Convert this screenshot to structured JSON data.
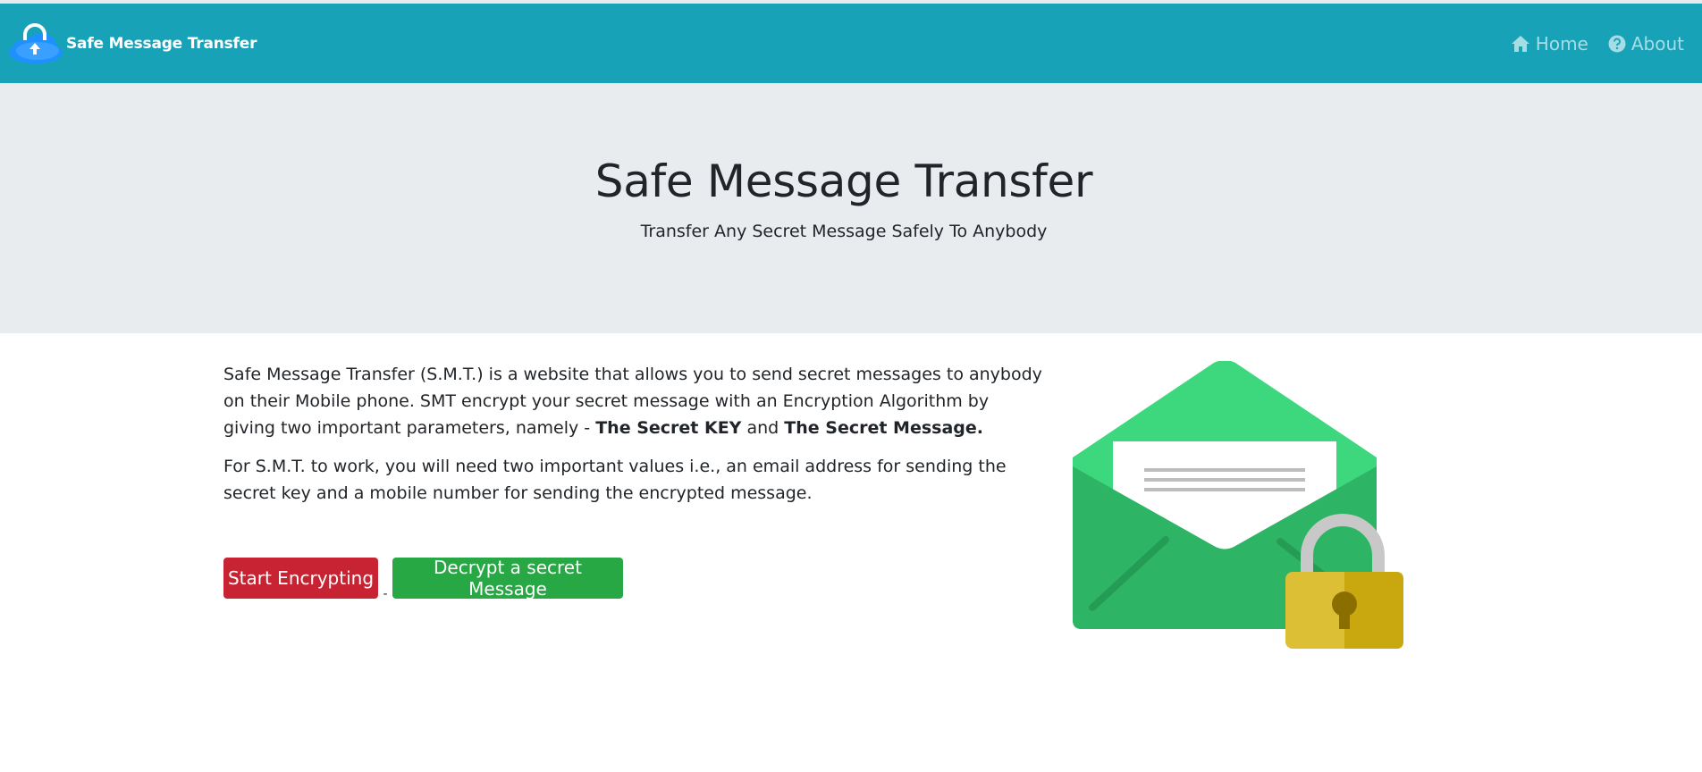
{
  "navbar": {
    "brand": "Safe Message Transfer",
    "links": [
      {
        "label": "Home",
        "icon": "home-icon"
      },
      {
        "label": "About",
        "icon": "question-circle-icon"
      }
    ]
  },
  "hero": {
    "title": "Safe Message Transfer",
    "subtitle": "Transfer Any Secret Message Safely To Anybody"
  },
  "content": {
    "p1_text": "Safe Message Transfer (S.M.T.) is a website that allows you to send secret messages to anybody on their Mobile phone. SMT encrypt your secret message with an Encryption Algorithm by giving two important parameters, namely - ",
    "p1_bold1": "The Secret KEY",
    "p1_and": " and ",
    "p1_bold2": "The Secret Message.",
    "p2": "For S.M.T. to work, you will need two important values i.e., an email address for sending the secret key and a mobile number for sending the encrypted message."
  },
  "buttons": {
    "encrypt": "Start Encrypting",
    "separator": "-",
    "decrypt": "Decrypt a secret Message"
  },
  "colors": {
    "navbar": "#17a2b8",
    "hero_bg": "#e9ecef",
    "danger": "#c82333",
    "success": "#28a745"
  }
}
